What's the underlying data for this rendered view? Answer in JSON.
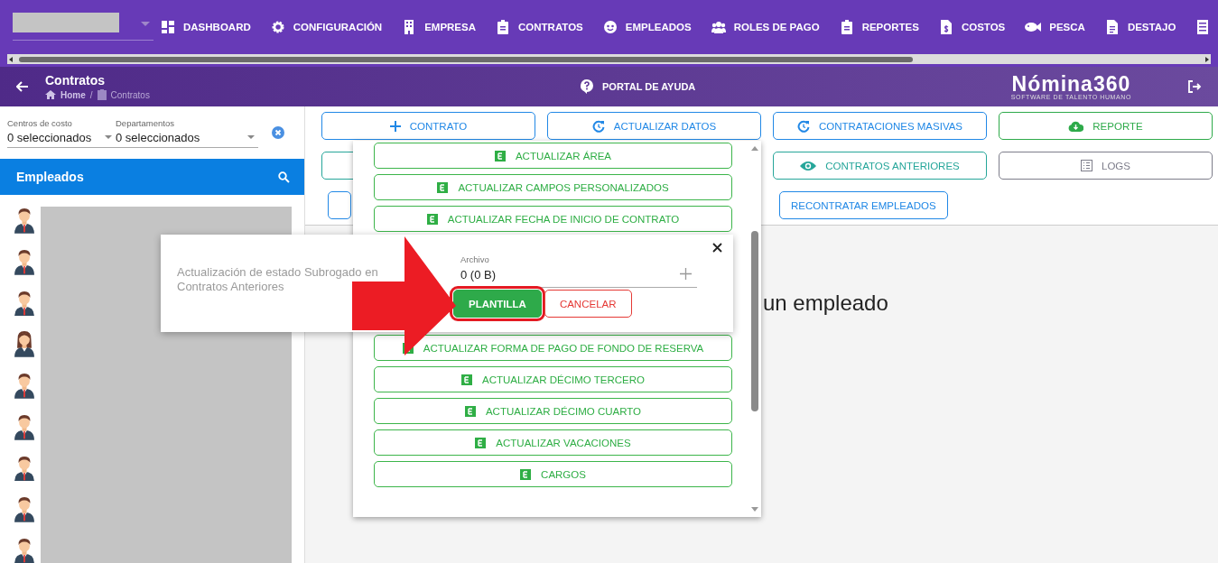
{
  "top_nav": {
    "items": [
      {
        "kind": "dashboard",
        "label": "DASHBOARD"
      },
      {
        "kind": "gear",
        "label": "CONFIGURACIÓN"
      },
      {
        "kind": "building",
        "label": "EMPRESA"
      },
      {
        "kind": "clipboard",
        "label": "CONTRATOS"
      },
      {
        "kind": "face",
        "label": "EMPLEADOS"
      },
      {
        "kind": "people",
        "label": "ROLES DE PAGO"
      },
      {
        "kind": "clipboard",
        "label": "REPORTES"
      },
      {
        "kind": "invoice",
        "label": "COSTOS"
      },
      {
        "kind": "fish",
        "label": "PESCA"
      },
      {
        "kind": "document",
        "label": "DESTAJO"
      },
      {
        "kind": "table"
      }
    ]
  },
  "header": {
    "title": "Contratos",
    "breadcrumb": [
      "Home",
      "Contratos"
    ],
    "breadcrumb_separator": "/",
    "help_link": "PORTAL DE AYUDA",
    "logo": "Nómina360",
    "logo_tagline": "SOFTWARE DE TALENTO HUMANO"
  },
  "filters": [
    {
      "label": "Centros de costo",
      "value": "0 seleccionados"
    },
    {
      "label": "Departamentos",
      "value": "0 seleccionados"
    }
  ],
  "employee_panel": {
    "title": "Empleados",
    "employees": [
      {
        "kind": "male"
      },
      {
        "kind": "male"
      },
      {
        "kind": "male"
      },
      {
        "kind": "female"
      },
      {
        "kind": "male"
      },
      {
        "kind": "male"
      },
      {
        "kind": "male"
      },
      {
        "kind": "male"
      },
      {
        "kind": "male"
      }
    ]
  },
  "action_rows": [
    [
      {
        "kind": "primary",
        "label": "CONTRATO"
      },
      {
        "kind": "primary",
        "label": "ACTUALIZAR DATOS"
      },
      {
        "kind": "primary",
        "label": "CONTRATACIONES MASIVAS"
      },
      {
        "kind": "success",
        "label": "REPORTE"
      }
    ],
    [
      {
        "kind": "info"
      },
      {
        "kind": "primary"
      },
      {
        "kind": "info",
        "label": "CONTRATOS ANTERIORES"
      },
      {
        "kind": "secondary",
        "label": "LOGS"
      }
    ],
    [
      {
        "kind": "primary"
      },
      {
        "kind": "none"
      },
      {
        "kind": "primary",
        "label": "RECONTRATAR EMPLEADOS"
      }
    ]
  ],
  "dropdown": {
    "items": [
      {
        "label": "ACTUALIZAR ÁREA"
      },
      {
        "label": "ACTUALIZAR CAMPOS PERSONALIZADOS"
      },
      {
        "label": "ACTUALIZAR FECHA DE INICIO DE CONTRATO"
      },
      {
        "label": "ACTUALIZAR FORMA DE PAGO DE FONDO DE RESERVA"
      },
      {
        "label": "ACTUALIZAR DÉCIMO TERCERO"
      },
      {
        "label": "ACTUALIZAR DÉCIMO CUARTO"
      },
      {
        "label": "ACTUALIZAR VACACIONES"
      },
      {
        "label": "CARGOS"
      }
    ]
  },
  "dialog": {
    "description": "Actualización de estado Subrogado en Contratos Anteriores",
    "file_field": {
      "label": "Archivo",
      "value": "0 (0 B)"
    },
    "buttons": [
      {
        "kind": "success",
        "label": "PLANTILLA",
        "highlighted": true
      },
      {
        "kind": "danger",
        "label": "CANCELAR",
        "highlighted": false
      }
    ]
  },
  "main": {
    "message": "un empleado"
  }
}
